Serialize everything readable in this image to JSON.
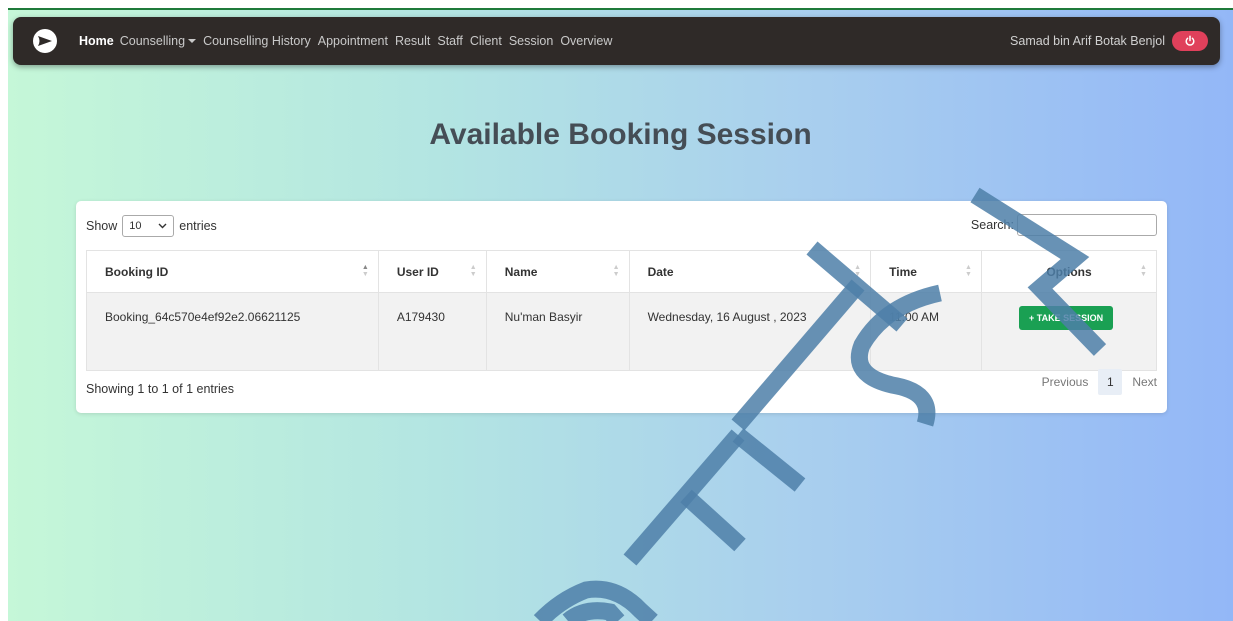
{
  "navbar": {
    "links": [
      "Home",
      "Counselling",
      "Counselling History",
      "Appointment",
      "Result",
      "Staff",
      "Client",
      "Session",
      "Overview"
    ],
    "user_name": "Samad bin Arif Botak Benjol",
    "logout_icon": "power-icon"
  },
  "page_title": "Available Booking Session",
  "controls": {
    "show_label": "Show",
    "entries_value": "10",
    "entries_label": "entries",
    "search_label": "Search:",
    "search_value": ""
  },
  "table": {
    "columns": [
      "Booking ID",
      "User ID",
      "Name",
      "Date",
      "Time",
      "Options"
    ],
    "rows": [
      {
        "booking_id": "Booking_64c570e4ef92e2.06621125",
        "user_id": "A179430",
        "name": "Nu'man Basyir",
        "date": "Wednesday, 16 August , 2023",
        "time": "11:00 AM",
        "action": "+ TAKE SESSION"
      }
    ]
  },
  "footer": {
    "info": "Showing 1 to 1 of 1 entries",
    "previous": "Previous",
    "current_page": "1",
    "next": "Next"
  },
  "watermark_text": "@FTSM",
  "colors": {
    "navbar_bg": "#2f2a28",
    "accent_green": "#1aa053",
    "logout_red": "#e0405b",
    "watermark": "#4d7fa8"
  }
}
